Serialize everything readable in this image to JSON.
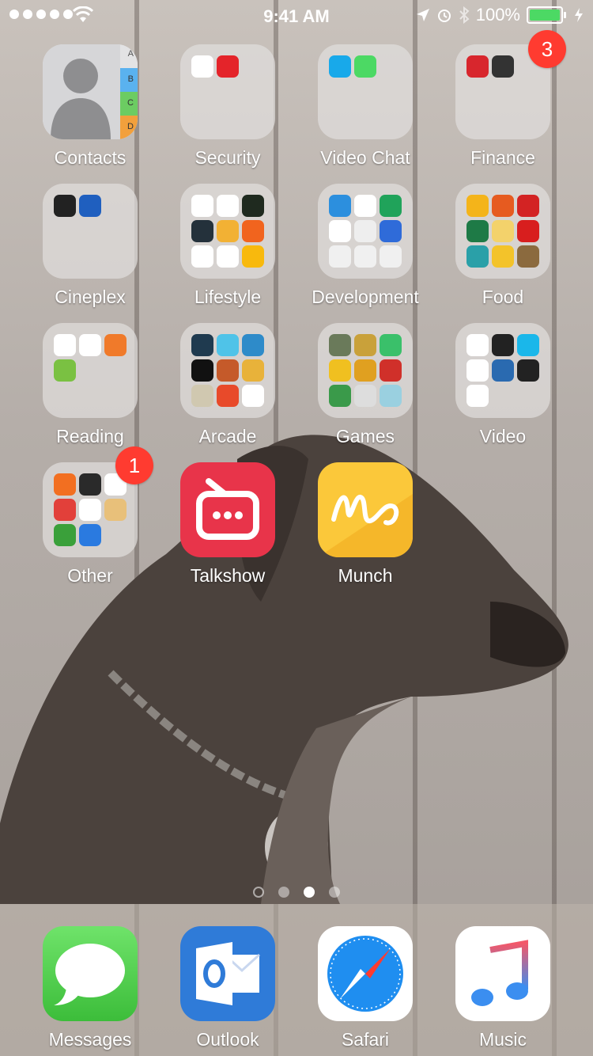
{
  "status_bar": {
    "time": "9:41 AM",
    "battery": "100%",
    "battery_level": 100,
    "signal_dots": 5,
    "icons": [
      "signal-dots-icon",
      "wifi-icon",
      "location-arrow-icon",
      "alarm-icon",
      "bluetooth-icon",
      "battery-icon",
      "charging-bolt-icon"
    ]
  },
  "home": {
    "apps": [
      {
        "label": "Contacts",
        "type": "app",
        "icon": "contacts-icon"
      },
      {
        "label": "Security",
        "type": "folder",
        "icon": "folder-icon"
      },
      {
        "label": "Video Chat",
        "type": "folder",
        "icon": "folder-icon"
      },
      {
        "label": "Finance",
        "type": "folder",
        "icon": "folder-icon",
        "badge": "3"
      },
      {
        "label": "Cineplex",
        "type": "folder",
        "icon": "folder-icon"
      },
      {
        "label": "Lifestyle",
        "type": "folder",
        "icon": "folder-icon"
      },
      {
        "label": "Development",
        "type": "folder",
        "icon": "folder-icon"
      },
      {
        "label": "Food",
        "type": "folder",
        "icon": "folder-icon"
      },
      {
        "label": "Reading",
        "type": "folder",
        "icon": "folder-icon"
      },
      {
        "label": "Arcade",
        "type": "folder",
        "icon": "folder-icon"
      },
      {
        "label": "Games",
        "type": "folder",
        "icon": "folder-icon"
      },
      {
        "label": "Video",
        "type": "folder",
        "icon": "folder-icon"
      },
      {
        "label": "Other",
        "type": "folder",
        "icon": "folder-icon",
        "badge": "1"
      },
      {
        "label": "Talkshow",
        "type": "app",
        "icon": "talkshow-radio-icon"
      },
      {
        "label": "Munch",
        "type": "app",
        "icon": "munch-scribble-icon"
      }
    ],
    "contacts_tabs": [
      "A",
      "B",
      "C",
      "D"
    ],
    "colors": {
      "talkshow": "#e8344a",
      "munch": "#fbc83a",
      "badge": "#ff3b30",
      "battery": "#4cd964"
    }
  },
  "page_indicator": {
    "pages": 4,
    "current": 3
  },
  "dock": {
    "apps": [
      {
        "label": "Messages",
        "icon": "messages-bubble-icon"
      },
      {
        "label": "Outlook",
        "icon": "outlook-icon"
      },
      {
        "label": "Safari",
        "icon": "safari-compass-icon"
      },
      {
        "label": "Music",
        "icon": "music-note-icon"
      }
    ]
  }
}
